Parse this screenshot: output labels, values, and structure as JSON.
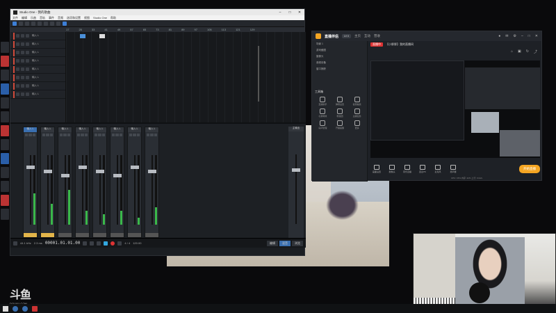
{
  "studio": {
    "title": "Studio One - 我的歌曲",
    "menu": [
      "文件",
      "编辑",
      "乐曲",
      "音轨",
      "事件",
      "音频",
      "选项和设置",
      "视图",
      "Studio One",
      "帮助"
    ],
    "ruler_marks": [
      "17",
      "25",
      "33",
      "41",
      "49",
      "57",
      "65",
      "73",
      "81",
      "89",
      "97",
      "105",
      "113",
      "121",
      "129"
    ],
    "tracks": [
      "输入 L",
      "输入 L",
      "输入 L",
      "输入 L",
      "输入 L",
      "输入 L",
      "输入 L",
      "输入 L"
    ],
    "mixer_channels": [
      "输入 L",
      "输入 L",
      "输入 L",
      "输入 L",
      "输入 L",
      "输入 L",
      "输入 L",
      "输入 L"
    ],
    "main_label": "主输出",
    "time": "00001.01.01.00",
    "sample_rate": "44.1 kHz",
    "latency": "2.3 ms",
    "tempo_label": "120.00",
    "time_sig": "4 / 4",
    "tabs": [
      "编辑",
      "混音",
      "浏览"
    ]
  },
  "broadcast": {
    "brand": "直播伴侣",
    "level": "LV 0",
    "tabs": [
      "主页",
      "互动",
      "营收"
    ],
    "scene_label": "场景 1",
    "sources": [
      "游戏截图",
      "摄像头",
      "音频设备",
      "窗口捕获"
    ],
    "tools_title": "工具箱",
    "tools": [
      "直播助手",
      "弹幕设置",
      "答题抽奖",
      "礼物特效",
      "粉丝团",
      "主播任务",
      "房间管理",
      "开播提醒",
      "更多"
    ],
    "room_title": "【小胖胖】我的直播间",
    "live_tag": "直播中",
    "bottom_tools": [
      "画面设置",
      "摄像头",
      "音乐直播",
      "连麦PK",
      "麦克风",
      "扬声器"
    ],
    "start_label": "开始直播",
    "status": "CPU: 15%  内存: 42%  上行: 0 kb/s"
  },
  "watermark": {
    "main": "斗鱼",
    "sub": "DOUYU.COM"
  }
}
